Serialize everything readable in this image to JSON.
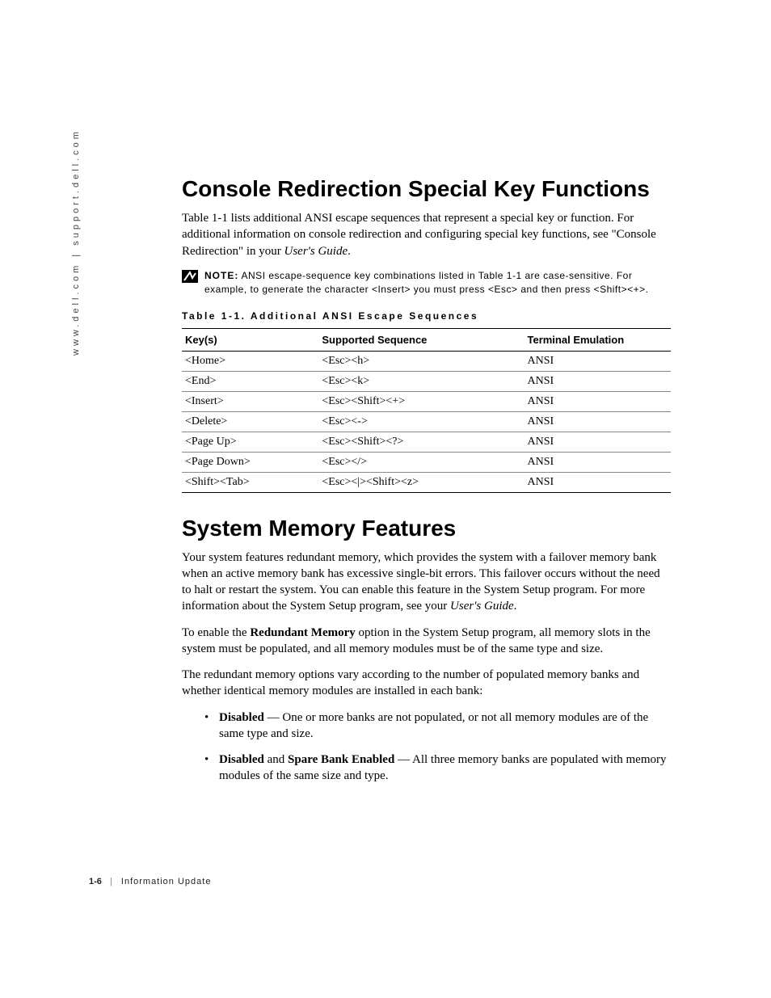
{
  "side_text": "www.dell.com | support.dell.com",
  "section1": {
    "heading": "Console Redirection Special Key Functions",
    "intro_prefix": "Table 1-1 lists additional ANSI escape sequences that represent a special key or function. For additional information on console redirection and configuring special key functions, see \"Console Redirection\" in your ",
    "intro_italic": "User's Guide",
    "intro_suffix": "."
  },
  "note": {
    "label": "NOTE:",
    "text": " ANSI escape-sequence key combinations listed in Table 1-1 are case-sensitive. For example, to generate the character <Insert> you must press <Esc> and then press <Shift><+>."
  },
  "table": {
    "caption": "Table 1-1. Additional ANSI Escape Sequences",
    "headers": [
      "Key(s)",
      "Supported Sequence",
      "Terminal Emulation"
    ],
    "rows": [
      [
        "<Home>",
        "<Esc><h>",
        "ANSI"
      ],
      [
        "<End>",
        "<Esc><k>",
        "ANSI"
      ],
      [
        "<Insert>",
        "<Esc><Shift><+>",
        "ANSI"
      ],
      [
        "<Delete>",
        "<Esc><->",
        "ANSI"
      ],
      [
        "<Page Up>",
        "<Esc><Shift><?>",
        "ANSI"
      ],
      [
        "<Page Down>",
        "<Esc></>",
        "ANSI"
      ],
      [
        "<Shift><Tab>",
        "<Esc><|><Shift><z>",
        "ANSI"
      ]
    ]
  },
  "section2": {
    "heading": "System Memory Features",
    "p1_prefix": "Your system features redundant memory, which provides the system with a failover memory bank when an active memory bank has excessive single-bit errors. This failover occurs without the need to halt or restart the system. You can enable this feature in the System Setup program. For more information about the System Setup program, see your ",
    "p1_italic": "User's Guide",
    "p1_suffix": ".",
    "p2_prefix": "To enable the ",
    "p2_bold": "Redundant Memory",
    "p2_suffix": " option in the System Setup program, all memory slots in the system must be populated, and all memory modules must be of the same type and size.",
    "p3": "The redundant memory options vary according to the number of populated memory banks and whether identical memory modules are installed in each bank:",
    "bullets": [
      {
        "bold1": "Disabled",
        "mid": " — One or more banks are not populated, or not all memory modules are of the same type and size.",
        "bold2": "",
        "tail": ""
      },
      {
        "bold1": "Disabled",
        "mid": " and ",
        "bold2": "Spare Bank Enabled",
        "tail": " — All three memory banks are populated with memory modules of the same size and type."
      }
    ]
  },
  "footer": {
    "page": "1-6",
    "title": "Information Update"
  }
}
